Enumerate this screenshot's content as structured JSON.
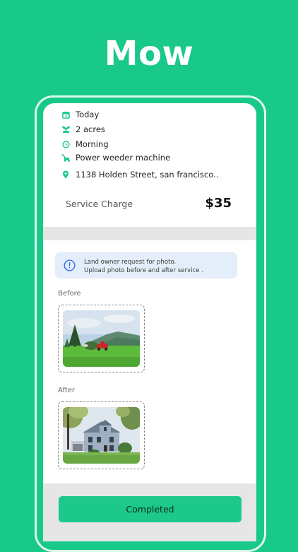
{
  "hero": {
    "title": "Mow"
  },
  "details": [
    {
      "icon": "calendar-icon",
      "text": "Today"
    },
    {
      "icon": "sprout-icon",
      "text": "2 acres"
    },
    {
      "icon": "clock-icon",
      "text": "Morning"
    },
    {
      "icon": "mower-icon",
      "text": "Power weeder machine"
    },
    {
      "icon": "location-pin-icon",
      "text": "1138  Holden Street, san francisco.."
    }
  ],
  "charge": {
    "label": "Service Charge",
    "value": "$35"
  },
  "alert": {
    "icon": "info-icon",
    "line1": "Land owner request for photo.",
    "line2": "Upload photo before and after service ."
  },
  "photos": {
    "before_label": "Before",
    "after_label": "After"
  },
  "action": {
    "label": "Completed"
  },
  "colors": {
    "brand": "#19c98a",
    "alert_bg": "#e4eefb",
    "alert_icon": "#2f6fe6"
  }
}
